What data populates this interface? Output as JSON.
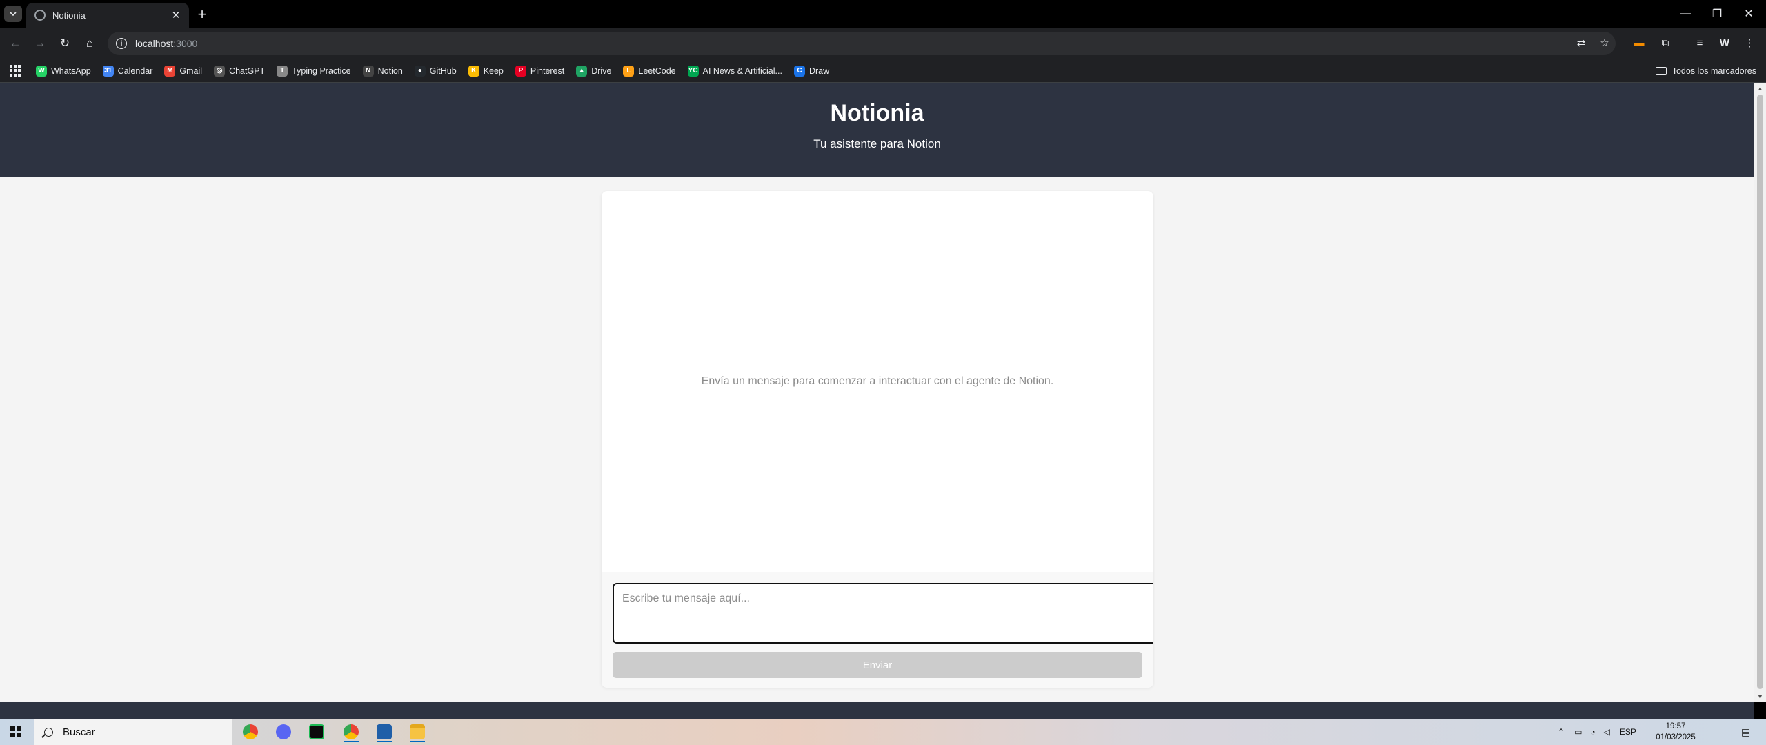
{
  "browser": {
    "tab_title": "Notionia",
    "url_host": "localhost",
    "url_port": ":3000",
    "bookmarks": [
      {
        "label": "WhatsApp",
        "color": "#25d366",
        "glyph": "W"
      },
      {
        "label": "Calendar",
        "color": "#4285f4",
        "glyph": "31"
      },
      {
        "label": "Gmail",
        "color": "#ea4335",
        "glyph": "M"
      },
      {
        "label": "ChatGPT",
        "color": "#555555",
        "glyph": "◎"
      },
      {
        "label": "Typing Practice",
        "color": "#888888",
        "glyph": "T"
      },
      {
        "label": "Notion",
        "color": "#444444",
        "glyph": "N"
      },
      {
        "label": "GitHub",
        "color": "#24292e",
        "glyph": "●"
      },
      {
        "label": "Keep",
        "color": "#fbbc04",
        "glyph": "K"
      },
      {
        "label": "Pinterest",
        "color": "#e60023",
        "glyph": "P"
      },
      {
        "label": "Drive",
        "color": "#1fa463",
        "glyph": "▲"
      },
      {
        "label": "LeetCode",
        "color": "#ffa116",
        "glyph": "L"
      },
      {
        "label": "AI News & Artificial...",
        "color": "#00a651",
        "glyph": "YC"
      },
      {
        "label": "Draw",
        "color": "#1a73e8",
        "glyph": "C"
      }
    ],
    "all_bookmarks_label": "Todos los marcadores"
  },
  "app": {
    "title": "Notionia",
    "subtitle": "Tu asistente para Notion",
    "empty_message": "Envía un mensaje para comenzar a interactuar con el agente de Notion.",
    "input_placeholder": "Escribe tu mensaje aquí...",
    "send_label": "Enviar",
    "header_color": "#2d3341"
  },
  "taskbar": {
    "search_label": "Buscar",
    "language": "ESP",
    "time": "19:57",
    "date": "01/03/2025"
  }
}
